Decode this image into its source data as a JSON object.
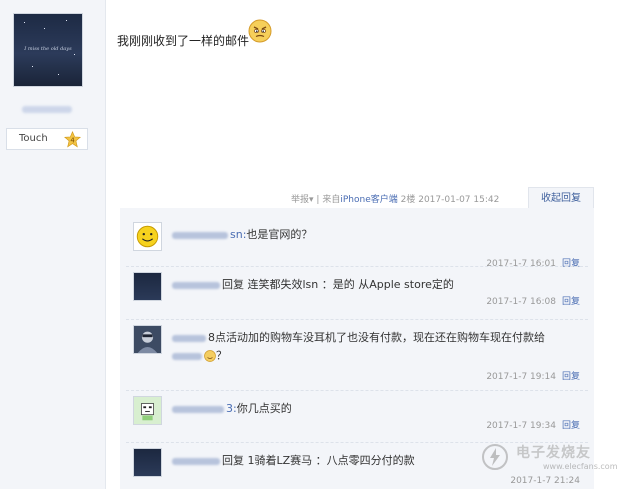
{
  "author": {
    "avatar_caption": "I miss the old days",
    "badge_label": "Touch",
    "badge_level": "4"
  },
  "post": {
    "text": "我刚刚收到了一样的邮件",
    "emoji": "angry-face-icon"
  },
  "meta": {
    "report": "举报",
    "source_prefix": "来自",
    "source_client": "iPhone客户端",
    "floor": "2楼",
    "datetime": "2017-01-07 15:42",
    "collapse_label": "收起回复"
  },
  "replies": [
    {
      "name_suffix": "sn:",
      "text": "也是官网的？",
      "date": "2017-1-7 16:01",
      "reply_label": "回复",
      "avatar": "smiley-face-icon"
    },
    {
      "name_suffix": "",
      "text": "回复 连笑都失效lsn ：是的 从Apple store定的",
      "date": "2017-1-7 16:08",
      "reply_label": "回复",
      "avatar": "night-sky-avatar"
    },
    {
      "name_suffix": "",
      "text": "8点活动加的购物车没耳机了也没有付款，现在还在购物车现在付款给",
      "text2": "？",
      "date": "2017-1-7 19:14",
      "reply_label": "回复",
      "avatar": "character-avatar"
    },
    {
      "name_suffix": "3:",
      "text": "你几点买的",
      "date": "2017-1-7 19:34",
      "reply_label": "回复",
      "avatar": "cartoon-avatar"
    },
    {
      "name_suffix": "",
      "text": "回复 1骑着LZ赛马 ：八点零四分付的款",
      "date": "2017-1-7 21:24",
      "reply_label": "回复",
      "avatar": "night-sky-avatar"
    }
  ],
  "watermark": {
    "line1": "电子发烧友",
    "line2": "www.elecfans.com"
  },
  "colors": {
    "link_blue": "#4a6db3",
    "panel_bg": "#f3f5f9"
  }
}
